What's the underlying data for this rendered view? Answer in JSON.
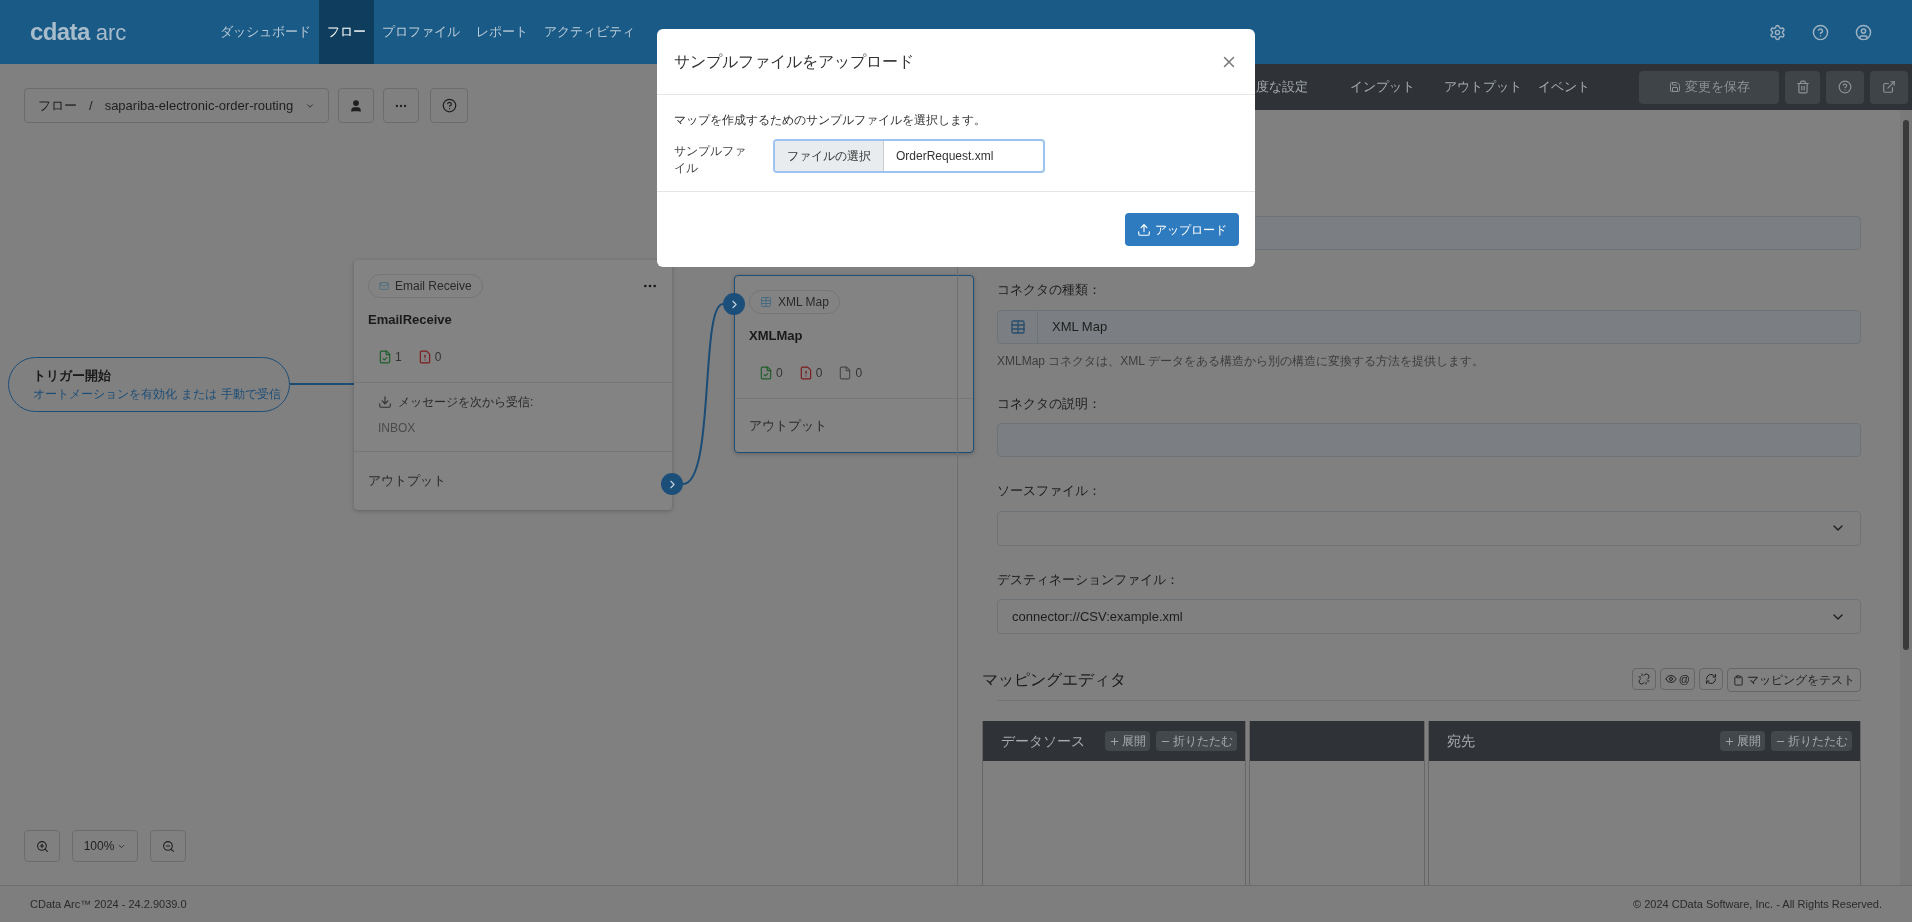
{
  "header": {
    "logo_main": "cdata",
    "logo_sub": "arc",
    "nav": [
      {
        "label": "ダッシュボード",
        "selected": false
      },
      {
        "label": "フロー",
        "selected": true
      },
      {
        "label": "プロファイル",
        "selected": false
      },
      {
        "label": "レポート",
        "selected": false
      },
      {
        "label": "アクティビティ",
        "selected": false
      }
    ]
  },
  "flow_toolbar": {
    "root": "フロー",
    "separator": "/",
    "flow_name": "sapariba-electronic-order-routing"
  },
  "trigger": {
    "title": "トリガー開始",
    "link_1": "オートメーションを有効化",
    "joiner": "または",
    "link_2": "手動で受信"
  },
  "nodes": [
    {
      "badge": "Email Receive",
      "name": "EmailReceive",
      "selected": false,
      "has_menu": true,
      "counts": [
        {
          "kind": "success",
          "value": "1"
        },
        {
          "kind": "error",
          "value": "0"
        }
      ],
      "receive_label": "メッセージを次から受信:",
      "receive_value": "INBOX",
      "output": "アウトプット"
    },
    {
      "badge": "XML Map",
      "name": "XMLMap",
      "selected": true,
      "has_menu": false,
      "counts": [
        {
          "kind": "success",
          "value": "0"
        },
        {
          "kind": "error",
          "value": "0"
        },
        {
          "kind": "pending",
          "value": "0"
        }
      ],
      "output": "アウトプット"
    }
  ],
  "zoom": {
    "level": "100%"
  },
  "panel": {
    "tabs": [
      {
        "label": "度な設定",
        "selected": false
      },
      {
        "label": "インプット",
        "selected": false
      },
      {
        "label": "アウトプット",
        "selected": false
      },
      {
        "label": "イベント",
        "selected": false
      }
    ],
    "save": "変更を保存",
    "fields": [
      {
        "kind": "readonly"
      },
      {
        "kind": "type",
        "label": "コネクタの種類：",
        "value": "XML Map",
        "help": "XMLMap コネクタは、XML データをある構造から別の構造に変換する方法を提供します。"
      },
      {
        "kind": "textarea",
        "label": "コネクタの説明："
      },
      {
        "kind": "select",
        "label": "ソースファイル："
      },
      {
        "kind": "select",
        "label": "デスティネーションファイル：",
        "value": "connector://CSV:example.xml"
      }
    ]
  },
  "mapping": {
    "title": "マッピングエディタ",
    "at_sign": "@",
    "test": "マッピングをテスト",
    "columns": [
      {
        "title": "データソース",
        "expand": "展開",
        "collapse": "折りたたむ"
      },
      {},
      {
        "title": "宛先",
        "expand": "展開",
        "collapse": "折りたたむ"
      }
    ]
  },
  "footer": {
    "version": "CData Arc™ 2024 - 24.2.9039.0",
    "copyright": "© 2024 CData Software, Inc. - All Rights Reserved."
  },
  "modal": {
    "title": "サンプルファイルをアップロード",
    "description": "マップを作成するためのサンプルファイルを選択します。",
    "field_label": "サンプルファイル",
    "choose": "ファイルの選択",
    "file_name": "OrderRequest.xml",
    "upload": "アップロード"
  }
}
